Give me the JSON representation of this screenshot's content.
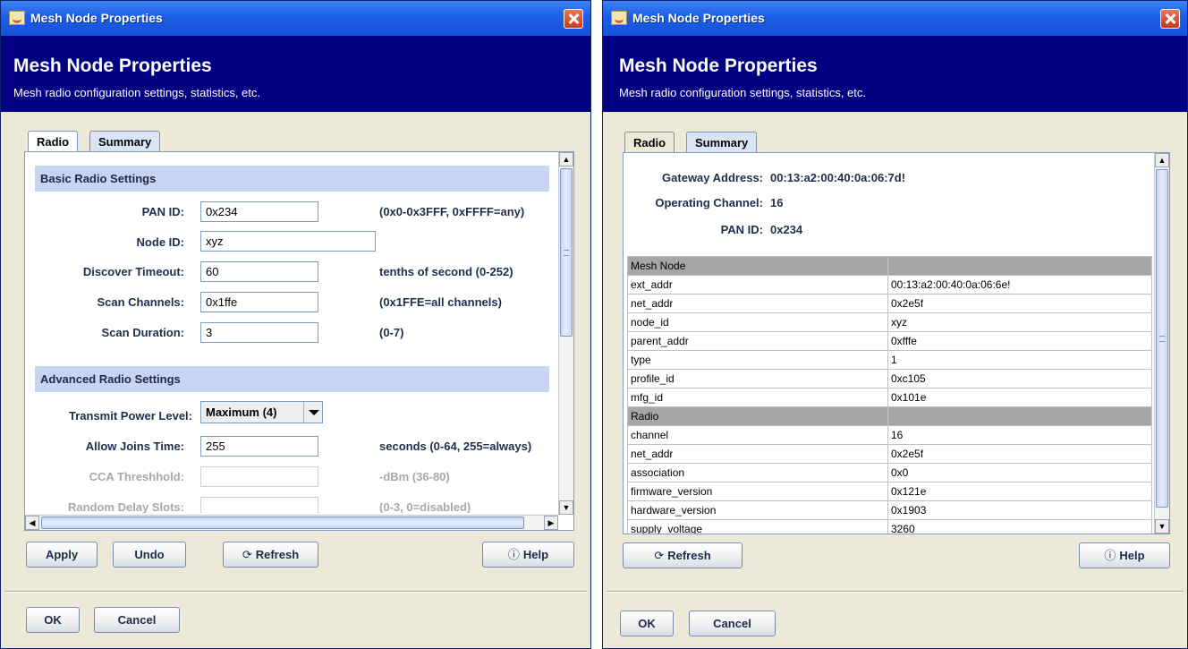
{
  "dialog_title": "Mesh Node Properties",
  "banner": {
    "title": "Mesh Node Properties",
    "subtitle": "Mesh radio configuration settings, statistics, etc."
  },
  "tabs": [
    "Radio",
    "Summary"
  ],
  "radio": {
    "basic_header": "Basic Radio Settings",
    "advanced_header": "Advanced Radio Settings",
    "pan_id": {
      "label": "PAN ID:",
      "value": "0x234",
      "hint": "(0x0-0x3FFF, 0xFFFF=any)"
    },
    "node_id": {
      "label": "Node ID:",
      "value": "xyz"
    },
    "discover_timeout": {
      "label": "Discover Timeout:",
      "value": "60",
      "hint": "tenths of second (0-252)"
    },
    "scan_channels": {
      "label": "Scan Channels:",
      "value": "0x1ffe",
      "hint": "(0x1FFE=all channels)"
    },
    "scan_duration": {
      "label": "Scan Duration:",
      "value": "3",
      "hint": "(0-7)"
    },
    "transmit_power": {
      "label": "Transmit Power Level:",
      "value": "Maximum (4)"
    },
    "allow_joins": {
      "label": "Allow Joins Time:",
      "value": "255",
      "hint": "seconds (0-64, 255=always)"
    },
    "cca_threshold": {
      "label": "CCA Threshhold:",
      "value": "",
      "hint": "-dBm (36-80)"
    },
    "random_delay": {
      "label": "Random Delay Slots:",
      "value": "",
      "hint": "(0-3, 0=disabled)"
    }
  },
  "buttons": {
    "apply": "Apply",
    "undo": "Undo",
    "refresh": "Refresh",
    "help": "Help",
    "ok": "OK",
    "cancel": "Cancel"
  },
  "summary": {
    "gateway_label": "Gateway Address:",
    "gateway_value": "00:13:a2:00:40:0a:06:7d!",
    "channel_label": "Operating Channel:",
    "channel_value": "16",
    "pan_label": "PAN ID:",
    "pan_value": "0x234",
    "table_rows": [
      {
        "group": true,
        "key": "Mesh Node",
        "value": ""
      },
      {
        "group": false,
        "key": "ext_addr",
        "value": "00:13:a2:00:40:0a:06:6e!"
      },
      {
        "group": false,
        "key": "net_addr",
        "value": "0x2e5f"
      },
      {
        "group": false,
        "key": "node_id",
        "value": "xyz"
      },
      {
        "group": false,
        "key": "parent_addr",
        "value": "0xfffe"
      },
      {
        "group": false,
        "key": "type",
        "value": "1"
      },
      {
        "group": false,
        "key": "profile_id",
        "value": "0xc105"
      },
      {
        "group": false,
        "key": "mfg_id",
        "value": "0x101e"
      },
      {
        "group": true,
        "key": "Radio",
        "value": ""
      },
      {
        "group": false,
        "key": "channel",
        "value": "16"
      },
      {
        "group": false,
        "key": "net_addr",
        "value": "0x2e5f"
      },
      {
        "group": false,
        "key": "association",
        "value": "0x0"
      },
      {
        "group": false,
        "key": "firmware_version",
        "value": "0x121e"
      },
      {
        "group": false,
        "key": "hardware_version",
        "value": "0x1903"
      },
      {
        "group": false,
        "key": "supply_voltage",
        "value": "3260"
      }
    ]
  },
  "icons": {
    "app": "java-cup-icon",
    "close": "close-icon",
    "refresh": "refresh-icon",
    "help": "help-icon"
  },
  "colors": {
    "titlebar": "#1c5fe6",
    "banner": "#000080",
    "section_header": "#c7d4f4",
    "group_row": "#a6a6a6"
  }
}
